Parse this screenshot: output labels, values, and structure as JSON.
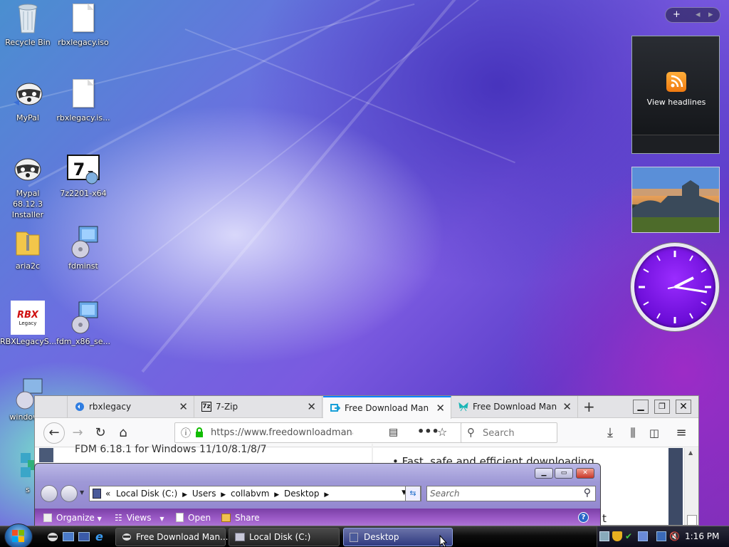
{
  "desktop": {
    "icons": [
      {
        "label": "Recycle Bin",
        "icon": "recycle-bin-icon"
      },
      {
        "label": "rbxlegacy.iso",
        "icon": "file-icon"
      },
      {
        "label": "MyPal",
        "icon": "mypal-icon"
      },
      {
        "label": "rbxlegacy.is...",
        "icon": "file-icon"
      },
      {
        "label": "Mypal 68.12.3 Installer",
        "icon": "mypal-installer-icon"
      },
      {
        "label": "7z2201-x64",
        "icon": "7zip-installer-icon"
      },
      {
        "label": "aria2c",
        "icon": "zip-folder-icon"
      },
      {
        "label": "fdminst",
        "icon": "installer-icon"
      },
      {
        "label": "RBXLegacyS...",
        "icon": "rbx-legacy-icon"
      },
      {
        "label": "fdm_x86_se...",
        "icon": "installer-icon"
      },
      {
        "label": "window...",
        "icon": "installer-icon"
      },
      {
        "label": "s",
        "icon": "app-icon"
      }
    ]
  },
  "sidebar": {
    "controls": {
      "add": "+",
      "prev": "◂",
      "next": "▸"
    },
    "feed_gadget": {
      "label": "View headlines"
    },
    "clock_gadget": {
      "time": "1:16"
    }
  },
  "firefox": {
    "tabs": [
      {
        "title": "rbxlegacy",
        "active": false
      },
      {
        "title": "7-Zip",
        "active": false
      },
      {
        "title": "Free Download Manag",
        "active": true
      },
      {
        "title": "Free Download Manag",
        "active": false
      }
    ],
    "new_tab": "+",
    "url": "https://www.freedownloadmanage",
    "search_placeholder": "Search",
    "content": {
      "heading_partial": "FDM 6.18.1 for Windows 11/10/8.1/8/7",
      "bullet_partial": "Fast, safe and efficient downloading",
      "partial_char": "t"
    }
  },
  "explorer": {
    "breadcrumb": [
      "«",
      "Local Disk (C:)",
      "Users",
      "collabvm",
      "Desktop"
    ],
    "search_placeholder": "Search",
    "toolbar": {
      "organize": "Organize",
      "views": "Views",
      "open": "Open",
      "share": "Share"
    }
  },
  "taskbar": {
    "buttons": [
      {
        "label": "Free Download Man...",
        "active": false
      },
      {
        "label": "Local Disk (C:)",
        "active": false
      },
      {
        "label": "Desktop",
        "active": true
      }
    ],
    "clock": "1:16 PM"
  }
}
